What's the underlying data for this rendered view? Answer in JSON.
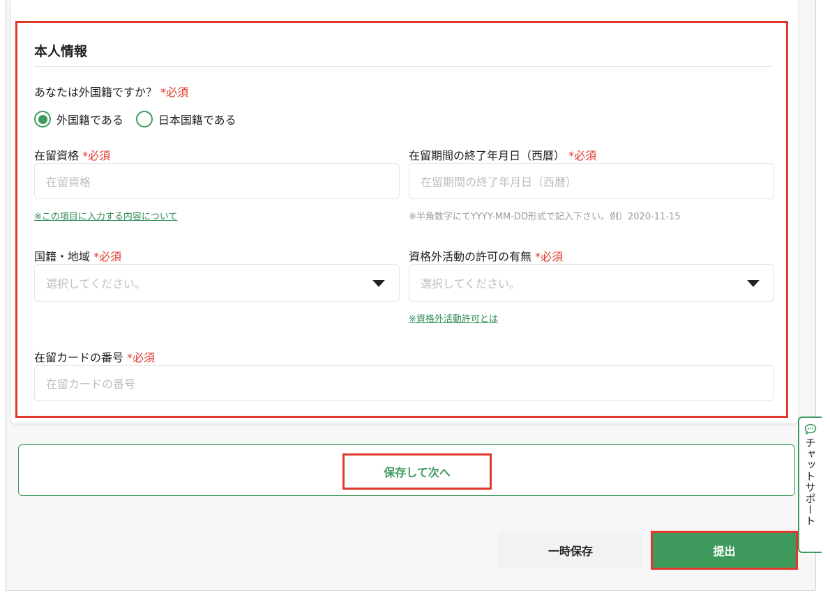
{
  "section": {
    "title": "本人情報"
  },
  "nationality_question": {
    "label": "あなたは外国籍ですか？",
    "required": "*必須"
  },
  "radio_options": [
    {
      "label": "外国籍である",
      "selected": true
    },
    {
      "label": "日本国籍である",
      "selected": false
    }
  ],
  "residence_status": {
    "label": "在留資格",
    "required": "*必須",
    "placeholder": "在留資格",
    "help_link": "※この項目に入力する内容について"
  },
  "residence_end": {
    "label": "在留期間の終了年月日（西暦）",
    "required": "*必須",
    "placeholder": "在留期間の終了年月日（西暦）",
    "hint": "※半角数字にてYYYY-MM-DD形式で記入下さい。例）2020-11-15"
  },
  "country": {
    "label": "国籍・地域",
    "required": "*必須",
    "placeholder": "選択してください。"
  },
  "work_permit": {
    "label": "資格外活動の許可の有無",
    "required": "*必須",
    "placeholder": "選択してください。",
    "help_link": "※資格外活動許可とは"
  },
  "residence_card": {
    "label": "在留カードの番号",
    "required": "*必須",
    "placeholder": "在留カードの番号"
  },
  "buttons": {
    "save_next": "保存して次へ",
    "temp_save": "一時保存",
    "submit": "提出"
  },
  "chat": {
    "label": "チャットサポート",
    "icon": "chat-bubble-icon"
  },
  "colors": {
    "accent": "#3d9a5c",
    "required": "#e0392b",
    "highlight": "#e0392b"
  }
}
